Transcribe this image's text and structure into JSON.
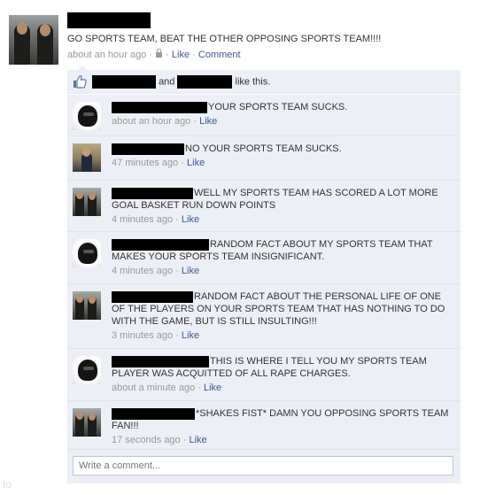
{
  "post": {
    "status": "GO SPORTS TEAM, BEAT THE OTHER OPPOSING SPORTS TEAM!!!!",
    "time": "about an hour ago",
    "sep1": "·",
    "sep2": "·",
    "sep3": "·",
    "like_label": "Like",
    "comment_label": "Comment"
  },
  "likes": {
    "and_text": "and",
    "suffix": "like this."
  },
  "comments": [
    {
      "text": "YOUR SPORTS TEAM SUCKS.",
      "time": "about an hour ago",
      "like": "Like",
      "avatar": "dark-masked-avatar"
    },
    {
      "text": "NO YOUR SPORTS TEAM SUCKS.",
      "time": "47 minutes ago",
      "like": "Like",
      "avatar": "person-in-suit-avatar"
    },
    {
      "text": "WELL MY SPORTS TEAM HAS SCORED A LOT MORE GOAL BASKET RUN DOWN POINTS",
      "time": "4 minutes ago",
      "like": "Like",
      "avatar": "two-men-avatar"
    },
    {
      "text": "RANDOM FACT ABOUT MY SPORTS TEAM THAT MAKES YOUR SPORTS TEAM INSIGNIFICANT.",
      "time": "4 minutes ago",
      "like": "Like",
      "avatar": "dark-masked-avatar"
    },
    {
      "text": "RANDOM FACT ABOUT THE PERSONAL LIFE OF ONE OF THE PLAYERS ON YOUR SPORTS TEAM THAT HAS NOTHING TO DO WITH THE GAME, BUT IS STILL INSULTING!!!",
      "time": "3 minutes ago",
      "like": "Like",
      "avatar": "two-men-avatar"
    },
    {
      "text": "THIS IS WHERE I TELL YOU MY SPORTS TEAM PLAYER WAS ACQUITTED OF ALL RAPE CHARGES.",
      "time": "about a minute ago",
      "like": "Like",
      "avatar": "dark-masked-avatar"
    },
    {
      "text": "*SHAKES FIST* DAMN YOU OPPOSING SPORTS TEAM FAN!!!",
      "time": "17 seconds ago",
      "like": "Like",
      "avatar": "two-men-avatar"
    }
  ],
  "write_comment": {
    "placeholder": "Write a comment..."
  },
  "corner": {
    "text": "to"
  },
  "colors": {
    "link": "#3b5998",
    "meta": "#999999",
    "panel": "#eceff5",
    "redaction": "#000000"
  },
  "icons": {
    "like_summary": "thumbs-up-icon",
    "privacy": "lock-icon"
  }
}
